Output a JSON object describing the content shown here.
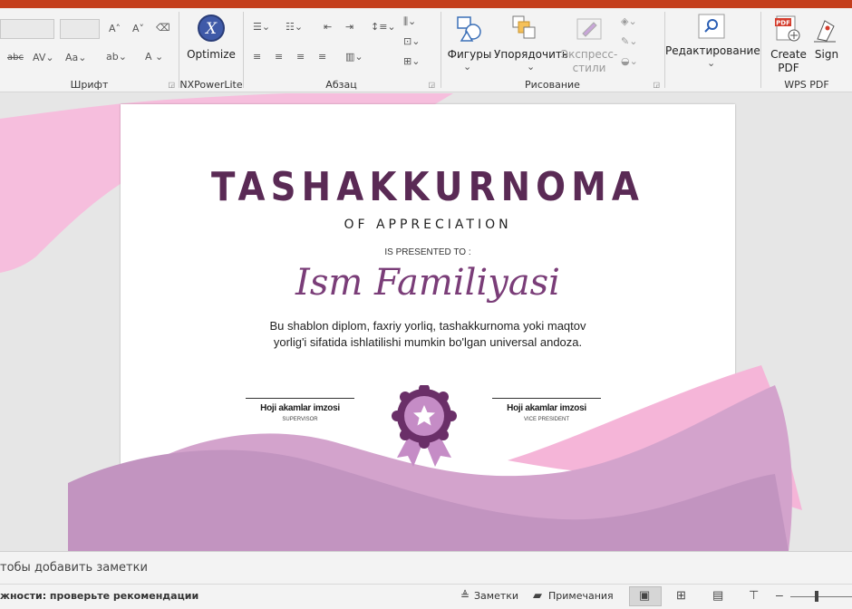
{
  "ribbon": {
    "groups": {
      "font": "Шрифт",
      "nxpower": "NXPowerLite",
      "paragraph": "Абзац",
      "drawing": "Рисование",
      "wps": "WPS PDF"
    },
    "buttons": {
      "optimize": "Optimize",
      "shapes": "Фигуры",
      "arrange": "Упорядочить",
      "quick_styles_1": "Экспресс-",
      "quick_styles_2": "стили",
      "editing": "Редактирование",
      "create_pdf_1": "Create",
      "create_pdf_2": "PDF",
      "sign": "Sign"
    }
  },
  "slide": {
    "title": "TASHAKKURNOMA",
    "subtitle": "OF APPRECIATION",
    "presented": "IS PRESENTED TO :",
    "name": "Ism Familiyasi",
    "body_line1": "Bu shablon diplom, faxriy yorliq, tashakkurnoma yoki maqtov",
    "body_line2": "yorlig'i sifatida ishlatilishi mumkin bo'lgan universal andoza.",
    "sig_left_name": "Hoji akamlar imzosi",
    "sig_left_role": "SUPERVISOR",
    "sig_right_name": "Hoji akamlar imzosi",
    "sig_right_role": "VICE PRESIDENT"
  },
  "notes": {
    "placeholder": "тобы добавить заметки"
  },
  "status": {
    "accessibility": "жности: проверьте рекомендации",
    "notes_btn": "Заметки",
    "comments_btn": "Примечания"
  },
  "colors": {
    "accent_red": "#c43e1c",
    "title_purple": "#5a2a55",
    "pink": "#f6b9dc",
    "mauve": "#b98ab6"
  }
}
